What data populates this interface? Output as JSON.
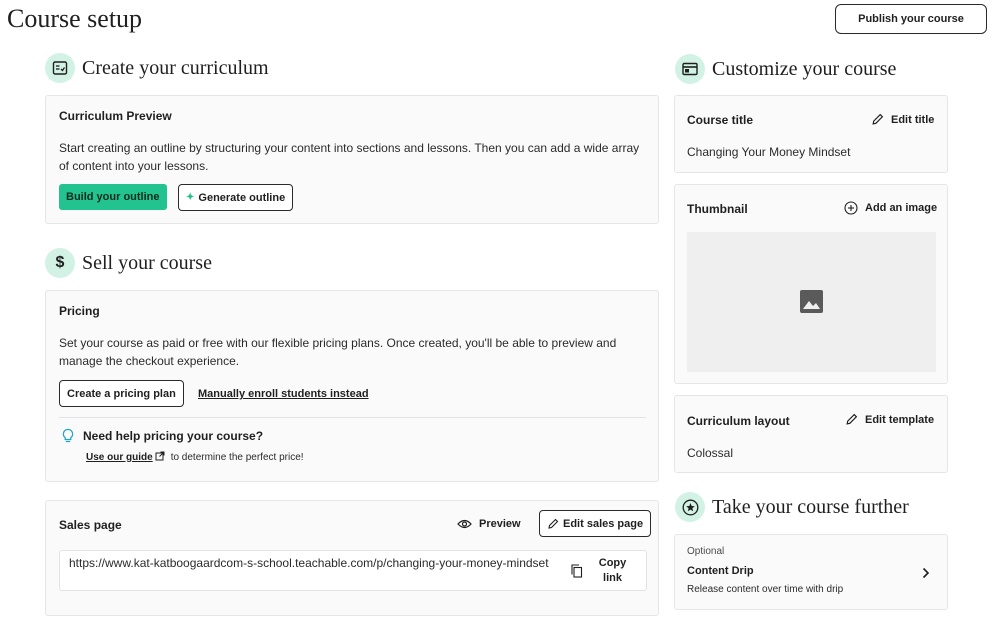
{
  "page": {
    "title": "Course setup",
    "publish_label": "Publish your course"
  },
  "curriculum": {
    "section_title": "Create your curriculum",
    "card_label": "Curriculum Preview",
    "description": "Start creating an outline by structuring your content into sections and lessons. Then you can add a wide array of content into your lessons.",
    "build_label": "Build your outline",
    "generate_label": "Generate outline"
  },
  "sell": {
    "section_title": "Sell your course",
    "card_label": "Pricing",
    "description": "Set your course as paid or free with our flexible pricing plans. Once created, you'll be able to preview and manage the checkout experience.",
    "create_plan_label": "Create a pricing plan",
    "manual_enroll_label": "Manually enroll students instead",
    "help_title": "Need help pricing your course?",
    "guide_link": "Use our guide",
    "help_text": "to determine the perfect price!"
  },
  "sales_page": {
    "label": "Sales page",
    "preview_label": "Preview",
    "edit_label": "Edit sales page",
    "url": "https://www.kat-katboogaardcom-s-school.teachable.com/p/changing-your-money-mindset",
    "copy_label_1": "Copy",
    "copy_label_2": "link"
  },
  "customize": {
    "section_title": "Customize your course",
    "course_title_label": "Course title",
    "edit_title_label": "Edit title",
    "course_title_value": "Changing Your Money Mindset",
    "thumbnail_label": "Thumbnail",
    "add_image_label": "Add an image",
    "layout_label": "Curriculum layout",
    "edit_template_label": "Edit template",
    "layout_value": "Colossal"
  },
  "further": {
    "section_title": "Take your course further",
    "optional_label": "Optional",
    "drip_title": "Content Drip",
    "drip_text": "Release content over time with drip"
  },
  "colors": {
    "accent": "#22c38e",
    "icon_bg": "#d3f2e6",
    "card_bg": "#fafafa",
    "border": "#e6e6e6"
  }
}
